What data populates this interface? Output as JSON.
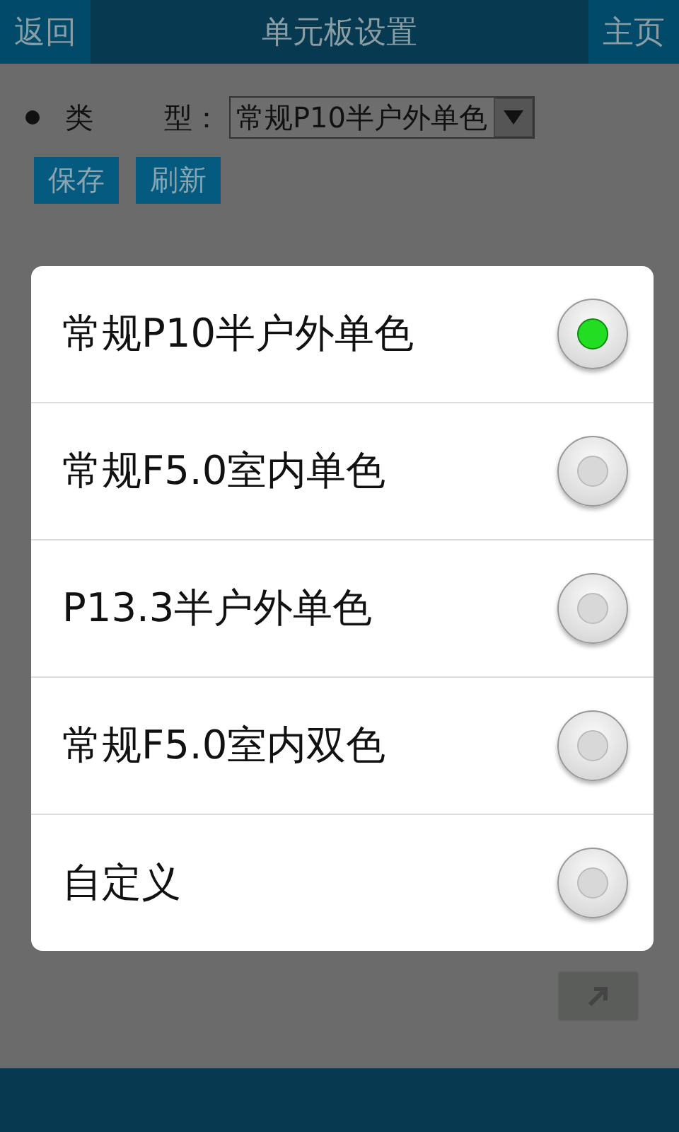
{
  "header": {
    "back": "返回",
    "title": "单元板设置",
    "home": "主页"
  },
  "form": {
    "label_1": "类",
    "label_2": "型：",
    "select_value": "常规P10半户外单色"
  },
  "buttons": [
    "保存",
    "刷新"
  ],
  "dialog": {
    "options": [
      {
        "label": "常规P10半户外单色",
        "selected": true
      },
      {
        "label": "常规F5.0室内单色",
        "selected": false
      },
      {
        "label": "P13.3半户外单色",
        "selected": false
      },
      {
        "label": "常规F5.0室内双色",
        "selected": false
      },
      {
        "label": "自定义",
        "selected": false
      }
    ]
  }
}
